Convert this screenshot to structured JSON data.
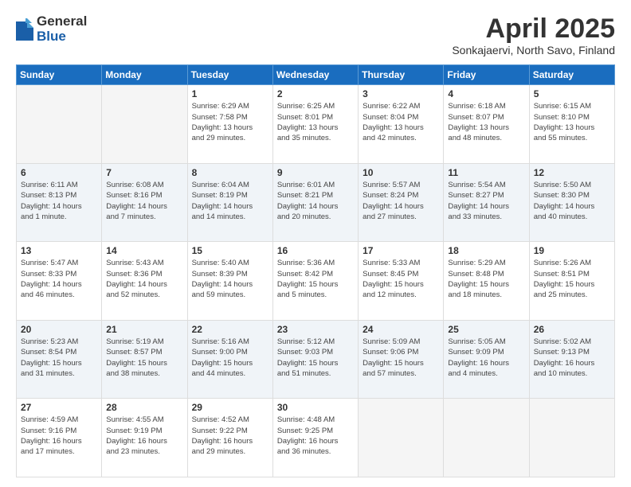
{
  "logo": {
    "general": "General",
    "blue": "Blue"
  },
  "title": "April 2025",
  "subtitle": "Sonkajaervi, North Savo, Finland",
  "weekdays": [
    "Sunday",
    "Monday",
    "Tuesday",
    "Wednesday",
    "Thursday",
    "Friday",
    "Saturday"
  ],
  "weeks": [
    [
      {
        "day": "",
        "info": ""
      },
      {
        "day": "",
        "info": ""
      },
      {
        "day": "1",
        "info": "Sunrise: 6:29 AM\nSunset: 7:58 PM\nDaylight: 13 hours\nand 29 minutes."
      },
      {
        "day": "2",
        "info": "Sunrise: 6:25 AM\nSunset: 8:01 PM\nDaylight: 13 hours\nand 35 minutes."
      },
      {
        "day": "3",
        "info": "Sunrise: 6:22 AM\nSunset: 8:04 PM\nDaylight: 13 hours\nand 42 minutes."
      },
      {
        "day": "4",
        "info": "Sunrise: 6:18 AM\nSunset: 8:07 PM\nDaylight: 13 hours\nand 48 minutes."
      },
      {
        "day": "5",
        "info": "Sunrise: 6:15 AM\nSunset: 8:10 PM\nDaylight: 13 hours\nand 55 minutes."
      }
    ],
    [
      {
        "day": "6",
        "info": "Sunrise: 6:11 AM\nSunset: 8:13 PM\nDaylight: 14 hours\nand 1 minute."
      },
      {
        "day": "7",
        "info": "Sunrise: 6:08 AM\nSunset: 8:16 PM\nDaylight: 14 hours\nand 7 minutes."
      },
      {
        "day": "8",
        "info": "Sunrise: 6:04 AM\nSunset: 8:19 PM\nDaylight: 14 hours\nand 14 minutes."
      },
      {
        "day": "9",
        "info": "Sunrise: 6:01 AM\nSunset: 8:21 PM\nDaylight: 14 hours\nand 20 minutes."
      },
      {
        "day": "10",
        "info": "Sunrise: 5:57 AM\nSunset: 8:24 PM\nDaylight: 14 hours\nand 27 minutes."
      },
      {
        "day": "11",
        "info": "Sunrise: 5:54 AM\nSunset: 8:27 PM\nDaylight: 14 hours\nand 33 minutes."
      },
      {
        "day": "12",
        "info": "Sunrise: 5:50 AM\nSunset: 8:30 PM\nDaylight: 14 hours\nand 40 minutes."
      }
    ],
    [
      {
        "day": "13",
        "info": "Sunrise: 5:47 AM\nSunset: 8:33 PM\nDaylight: 14 hours\nand 46 minutes."
      },
      {
        "day": "14",
        "info": "Sunrise: 5:43 AM\nSunset: 8:36 PM\nDaylight: 14 hours\nand 52 minutes."
      },
      {
        "day": "15",
        "info": "Sunrise: 5:40 AM\nSunset: 8:39 PM\nDaylight: 14 hours\nand 59 minutes."
      },
      {
        "day": "16",
        "info": "Sunrise: 5:36 AM\nSunset: 8:42 PM\nDaylight: 15 hours\nand 5 minutes."
      },
      {
        "day": "17",
        "info": "Sunrise: 5:33 AM\nSunset: 8:45 PM\nDaylight: 15 hours\nand 12 minutes."
      },
      {
        "day": "18",
        "info": "Sunrise: 5:29 AM\nSunset: 8:48 PM\nDaylight: 15 hours\nand 18 minutes."
      },
      {
        "day": "19",
        "info": "Sunrise: 5:26 AM\nSunset: 8:51 PM\nDaylight: 15 hours\nand 25 minutes."
      }
    ],
    [
      {
        "day": "20",
        "info": "Sunrise: 5:23 AM\nSunset: 8:54 PM\nDaylight: 15 hours\nand 31 minutes."
      },
      {
        "day": "21",
        "info": "Sunrise: 5:19 AM\nSunset: 8:57 PM\nDaylight: 15 hours\nand 38 minutes."
      },
      {
        "day": "22",
        "info": "Sunrise: 5:16 AM\nSunset: 9:00 PM\nDaylight: 15 hours\nand 44 minutes."
      },
      {
        "day": "23",
        "info": "Sunrise: 5:12 AM\nSunset: 9:03 PM\nDaylight: 15 hours\nand 51 minutes."
      },
      {
        "day": "24",
        "info": "Sunrise: 5:09 AM\nSunset: 9:06 PM\nDaylight: 15 hours\nand 57 minutes."
      },
      {
        "day": "25",
        "info": "Sunrise: 5:05 AM\nSunset: 9:09 PM\nDaylight: 16 hours\nand 4 minutes."
      },
      {
        "day": "26",
        "info": "Sunrise: 5:02 AM\nSunset: 9:13 PM\nDaylight: 16 hours\nand 10 minutes."
      }
    ],
    [
      {
        "day": "27",
        "info": "Sunrise: 4:59 AM\nSunset: 9:16 PM\nDaylight: 16 hours\nand 17 minutes."
      },
      {
        "day": "28",
        "info": "Sunrise: 4:55 AM\nSunset: 9:19 PM\nDaylight: 16 hours\nand 23 minutes."
      },
      {
        "day": "29",
        "info": "Sunrise: 4:52 AM\nSunset: 9:22 PM\nDaylight: 16 hours\nand 29 minutes."
      },
      {
        "day": "30",
        "info": "Sunrise: 4:48 AM\nSunset: 9:25 PM\nDaylight: 16 hours\nand 36 minutes."
      },
      {
        "day": "",
        "info": ""
      },
      {
        "day": "",
        "info": ""
      },
      {
        "day": "",
        "info": ""
      }
    ]
  ]
}
